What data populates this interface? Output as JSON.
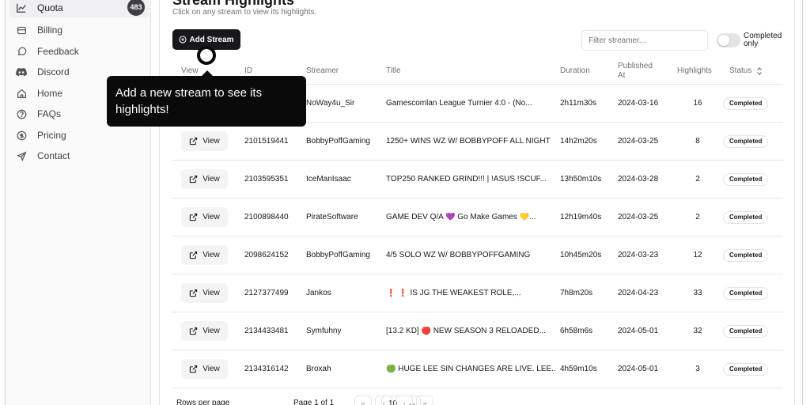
{
  "sidebar": {
    "items": [
      {
        "label": "Quota",
        "icon": "chart-line-icon",
        "badge": "483",
        "active": true
      },
      {
        "label": "Billing",
        "icon": "billing-icon"
      },
      {
        "label": "Feedback",
        "icon": "chat-bubble-icon"
      },
      {
        "label": "Discord",
        "icon": "discord-icon"
      },
      {
        "label": "Home",
        "icon": "home-icon"
      },
      {
        "label": "FAQs",
        "icon": "question-circle-icon"
      },
      {
        "label": "Pricing",
        "icon": "dollar-circle-icon"
      },
      {
        "label": "Contact",
        "icon": "send-icon"
      }
    ]
  },
  "header": {
    "title": "Stream Highlights",
    "subtitle": "Click on any stream to view its highlights."
  },
  "toolbar": {
    "add_label": "Add Stream",
    "filter_placeholder": "Filter streamer...",
    "toggle_label": "Completed only",
    "toggle_on": false
  },
  "table": {
    "columns": [
      "View",
      "ID",
      "Streamer",
      "Title",
      "Duration",
      "Published At",
      "Highlights",
      "Status"
    ],
    "sort_icon": "sort-updown-icon",
    "view_label": "View",
    "rows": [
      {
        "id": "",
        "streamer": "NoWay4u_Sir",
        "title": "Gamescomlan League Turnier 4:0 - (No...",
        "duration": "2h11m30s",
        "published": "2024-03-16",
        "highlights": "16",
        "status": "Completed"
      },
      {
        "id": "2101519441",
        "streamer": "BobbyPoffGaming",
        "title": "1250+ WINS WZ W/ BOBBYPOFF ALL NIGHT",
        "duration": "14h2m20s",
        "published": "2024-03-25",
        "highlights": "8",
        "status": "Completed"
      },
      {
        "id": "2103595351",
        "streamer": "IceManIsaac",
        "title": "TOP250 RANKED GRIND!!! | !ASUS !SCUF...",
        "duration": "13h50m10s",
        "published": "2024-03-28",
        "highlights": "2",
        "status": "Completed"
      },
      {
        "id": "2100898440",
        "streamer": "PirateSoftware",
        "title": "GAME DEV Q/A 💜 Go Make Games 💛...",
        "duration": "12h19m40s",
        "published": "2024-03-25",
        "highlights": "2",
        "status": "Completed"
      },
      {
        "id": "2098624152",
        "streamer": "BobbyPoffGaming",
        "title": "4/5 SOLO WZ W/ BOBBYPOFFGAMING",
        "duration": "10h45m20s",
        "published": "2024-03-23",
        "highlights": "12",
        "status": "Completed"
      },
      {
        "id": "2127377499",
        "streamer": "Jankos",
        "title": "❗ ❗ IS JG THE WEAKEST ROLE,...",
        "duration": "7h8m20s",
        "published": "2024-04-23",
        "highlights": "33",
        "status": "Completed"
      },
      {
        "id": "2134433481",
        "streamer": "Symfuhny",
        "title": "[13.2 KD] 🔴 NEW SEASON 3 RELOADED...",
        "duration": "6h58m6s",
        "published": "2024-05-01",
        "highlights": "32",
        "status": "Completed"
      },
      {
        "id": "2134316142",
        "streamer": "Broxah",
        "title": "🟢 HUGE LEE SIN CHANGES ARE LIVE. LEE...",
        "duration": "4h59m10s",
        "published": "2024-05-01",
        "highlights": "3",
        "status": "Completed"
      }
    ]
  },
  "tooltip": {
    "text": "Add a new stream to see its highlights!"
  },
  "footer": {
    "rows_per_page_label": "Rows per page",
    "rows_per_page_value": "10",
    "page_label": "Page 1 of 1",
    "nav": [
      "«",
      "‹",
      "›",
      "»"
    ]
  }
}
